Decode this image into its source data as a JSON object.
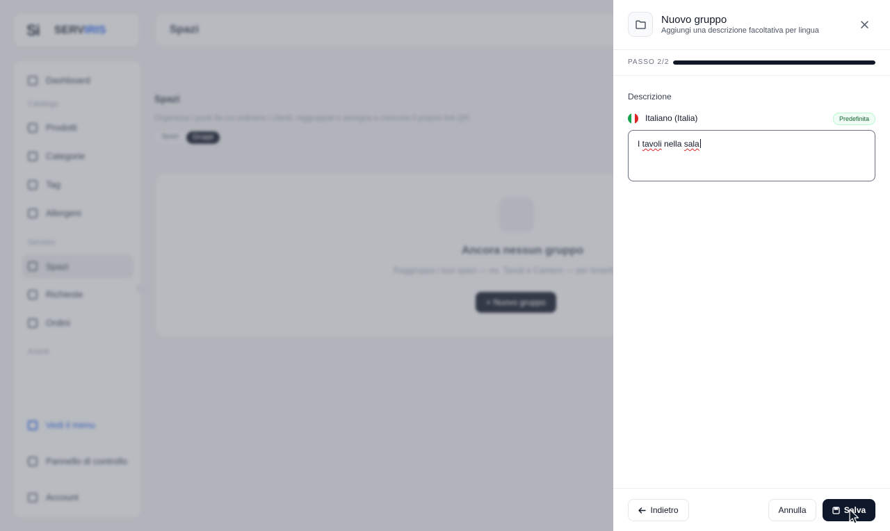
{
  "background": {
    "logo": {
      "mark": "Si",
      "text_a": "SERV",
      "text_b": "IRIS"
    },
    "topbar_title": "Spazi",
    "sidebar": {
      "items": [
        {
          "label": "Dashboard"
        },
        {
          "label": "Prodotti"
        },
        {
          "label": "Categorie"
        },
        {
          "label": "Tag"
        },
        {
          "label": "Allergeni"
        },
        {
          "label": "Spazi"
        },
        {
          "label": "Richieste"
        },
        {
          "label": "Ordini"
        }
      ],
      "sections": [
        "Catalogo",
        "Servizio",
        "Avanti"
      ],
      "footer": {
        "view_menu": "Vedi il menu",
        "control_panel": "Pannello di controllo",
        "account": "Account"
      }
    },
    "main": {
      "title": "Spazi",
      "subtitle": "Organizza i punti da cui ordinano i clienti: raggruppali e assegna a ciascuno il proprio link QR.",
      "segments": [
        "Spazi",
        "Gruppi"
      ],
      "empty_title": "Ancora nessun gruppo",
      "empty_desc": "Raggruppa i tuoi spazi — es. Tavoli e Camere — per tenerli in ordine.",
      "empty_button": "+ Nuovo gruppo"
    }
  },
  "drawer": {
    "title": "Nuovo gruppo",
    "subtitle": "Aggiungi una descrizione facoltativa per lingua",
    "step_label": "PASSO 2/2",
    "progress_percent": 100,
    "description_label": "Descrizione",
    "language": "Italiano (Italia)",
    "default_badge": "Predefinita",
    "text_value_word1": "I ",
    "text_value_word2": "tavoli",
    "text_value_word3": " nella ",
    "text_value_word4": "sala",
    "back_label": "Indietro",
    "cancel_label": "Annulla",
    "save_label": "Salva",
    "colors": {
      "primary": "#0f172a",
      "badge_bg": "#f0fdf4",
      "badge_text": "#166534"
    },
    "icons": [
      "folder-icon",
      "close-icon",
      "arrow-left-icon",
      "save-icon",
      "italy-flag-icon"
    ]
  }
}
